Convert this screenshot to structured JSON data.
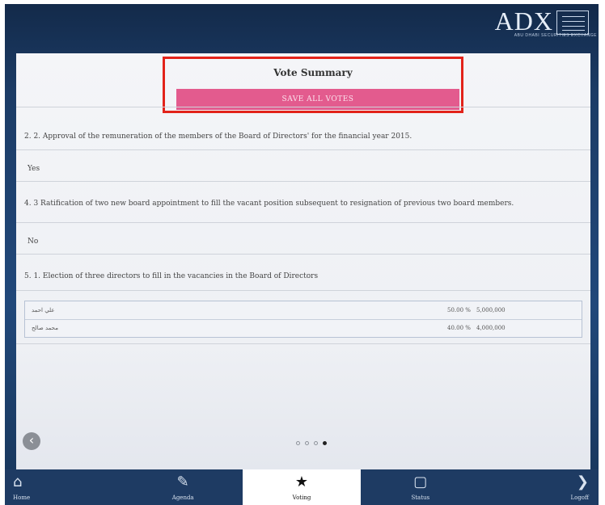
{
  "header": {
    "logo_text": "ADX",
    "logo_subtitle": "ABU DHABI SECURITIES EXCHANGE"
  },
  "summary": {
    "title": "Vote Summary",
    "save_label": "SAVE ALL VOTES"
  },
  "questions": [
    {
      "text": "2. 2. Approval of the remuneration of the members of the Board of Directors' for the financial year 2015.",
      "answer": "Yes"
    },
    {
      "text": "4. 3 Ratification of two new board appointment to fill the vacant position subsequent to resignation of previous two board members.",
      "answer": "No"
    },
    {
      "text": "5. 1. Election of three directors to fill in the vacancies in the Board of Directors"
    }
  ],
  "votes": [
    {
      "name": "علي احمد",
      "percent": "50.00 %",
      "amount": "5,000,000"
    },
    {
      "name": "محمد صالح",
      "percent": "40.00 %",
      "amount": "4,000,000"
    }
  ],
  "pager": {
    "count": 4,
    "active": 4
  },
  "nav": [
    {
      "label": "Home",
      "icon": "⌂",
      "icon_name": "home-icon"
    },
    {
      "label": "Agenda",
      "icon": "✎",
      "icon_name": "agenda-icon"
    },
    {
      "label": "Voting",
      "icon": "★",
      "icon_name": "star-icon"
    },
    {
      "label": "Status",
      "icon": "▢",
      "icon_name": "document-icon"
    },
    {
      "label": "Logoff",
      "icon": "❯",
      "icon_name": "chevron-right-icon"
    }
  ],
  "active_tab": "Voting",
  "colors": {
    "accent_pink": "#e35b8e",
    "highlight_red": "#e2231a",
    "nav_bg": "#1e3b63"
  }
}
